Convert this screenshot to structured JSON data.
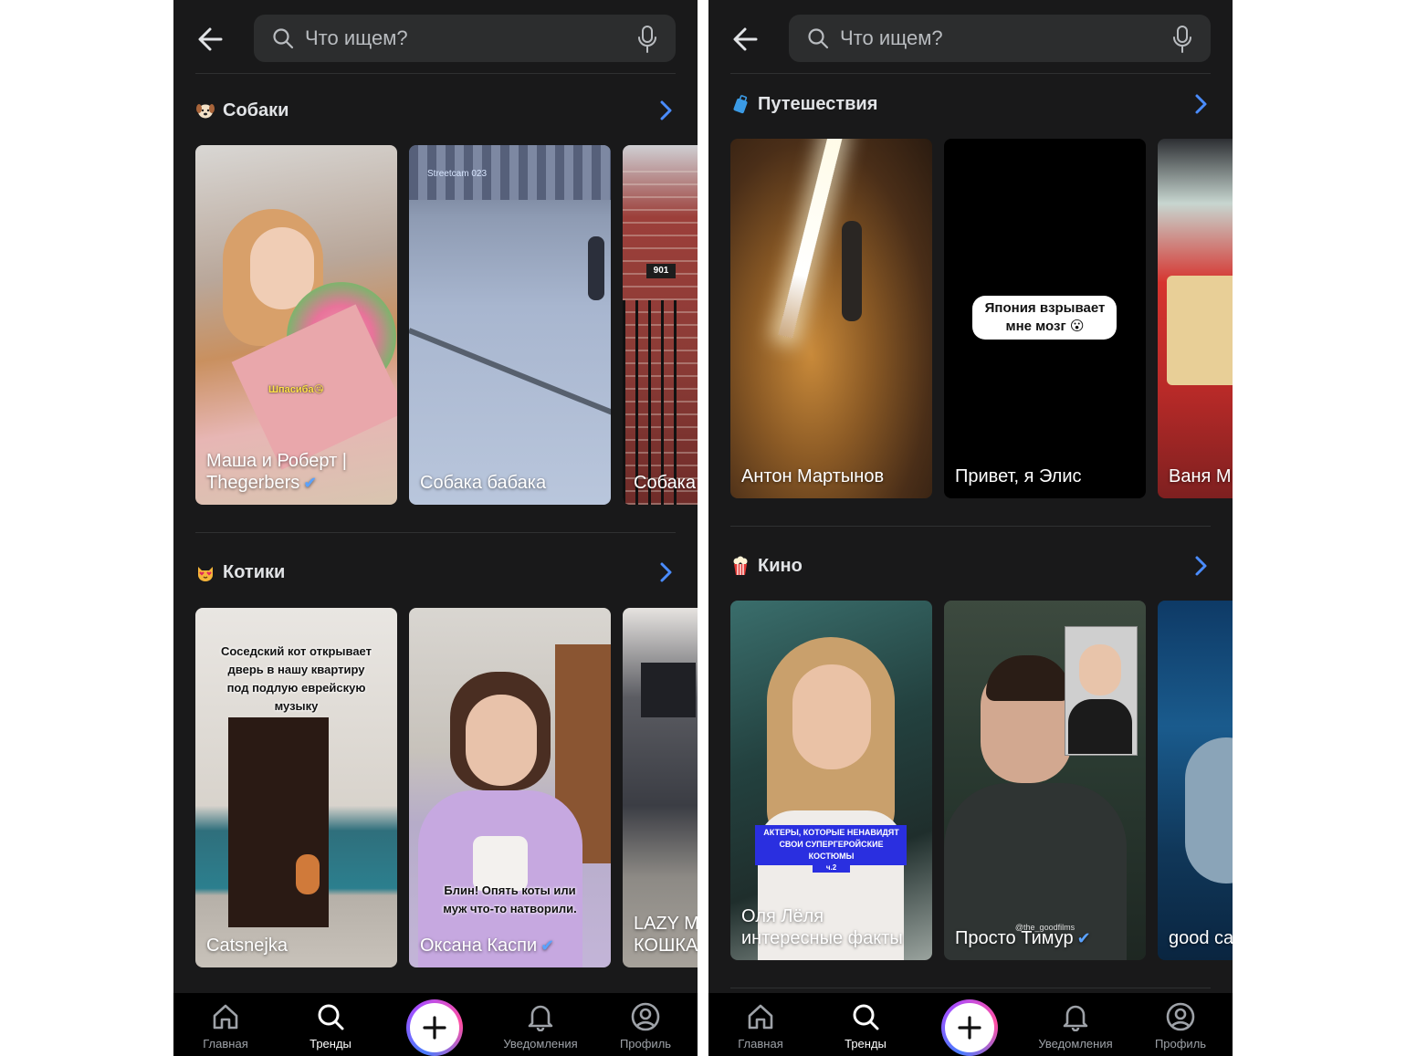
{
  "search": {
    "placeholder": "Что ищем?"
  },
  "nav": {
    "items": [
      {
        "label": "Главная",
        "icon": "home-icon"
      },
      {
        "label": "Тренды",
        "icon": "search-icon"
      },
      {
        "label": "",
        "icon": "plus-icon"
      },
      {
        "label": "Уведомления",
        "icon": "bell-icon"
      },
      {
        "label": "Профиль",
        "icon": "profile-icon"
      }
    ],
    "active": "Тренды"
  },
  "left": {
    "sections": [
      {
        "title": "Собаки",
        "icon": "dog-emoji-icon",
        "cards": [
          {
            "caption": "Маша и Роберт | Thegerbers",
            "verified": true,
            "overlay": "Шпасиба😘"
          },
          {
            "caption": "Собака бабака",
            "verified": false,
            "overlay": "Streetcam 023"
          },
          {
            "caption": "Собака",
            "verified": false,
            "overlay": "901"
          }
        ]
      },
      {
        "title": "Котики",
        "icon": "cat-emoji-icon",
        "cards": [
          {
            "caption": "Catsnejka",
            "verified": false,
            "overlay": "Соседский кот открывает дверь в нашу квартиру под подлую еврейскую музыку"
          },
          {
            "caption": "Оксана Каспи",
            "verified": true,
            "overlay": "Блин! Опять коты или муж что-то натворили."
          },
          {
            "caption": "LAZY M КОШКА",
            "verified": false,
            "overlay": ""
          }
        ]
      }
    ]
  },
  "right": {
    "sections": [
      {
        "title": "Путешествия",
        "icon": "luggage-emoji-icon",
        "cards": [
          {
            "caption": "Антон Мартынов",
            "verified": false,
            "overlay": ""
          },
          {
            "caption": "Привет, я Элис",
            "verified": false,
            "overlay": "Япония взрывает мне мозг 😮"
          },
          {
            "caption": "Ваня М",
            "verified": false,
            "overlay": ""
          }
        ]
      },
      {
        "title": "Кино",
        "icon": "popcorn-emoji-icon",
        "cards": [
          {
            "caption": "Оля Лёля интересные факты",
            "verified": false,
            "overlay": "АКТЕРЫ, КОТОРЫЕ НЕНАВИДЯТ СВОИ СУПЕРГЕРОЙСКИЕ КОСТЮМЫ",
            "overlay_sub": "ч.2"
          },
          {
            "caption": "Просто Тимур",
            "verified": true,
            "overlay": "@the_goodfilms"
          },
          {
            "caption": "good ca",
            "verified": false,
            "overlay": ""
          }
        ]
      }
    ]
  },
  "colors": {
    "background": "#19191a",
    "accent": "#4a7cff",
    "text": "#e1e3e6",
    "verified": "#5aa2ff"
  }
}
